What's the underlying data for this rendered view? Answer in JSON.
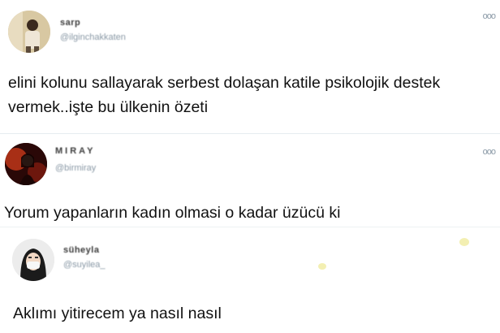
{
  "tweets": [
    {
      "name": "sarp",
      "handle": "@ilginchakkaten",
      "text": "elini kolunu sallayarak serbest dolaşan katile psikolojik destek vermek..işte bu ülkenin özeti",
      "more_icon": "ooo"
    },
    {
      "name": "MIRAY",
      "handle": "@birmiray",
      "text": "Yorum yapanların kadın olmasi o kadar üzücü ki",
      "more_icon": "ooo"
    },
    {
      "name": "süheyla",
      "handle": "@suyilea_",
      "text": "Aklımı yitirecem ya nasıl nasıl",
      "more_icon": ""
    }
  ]
}
